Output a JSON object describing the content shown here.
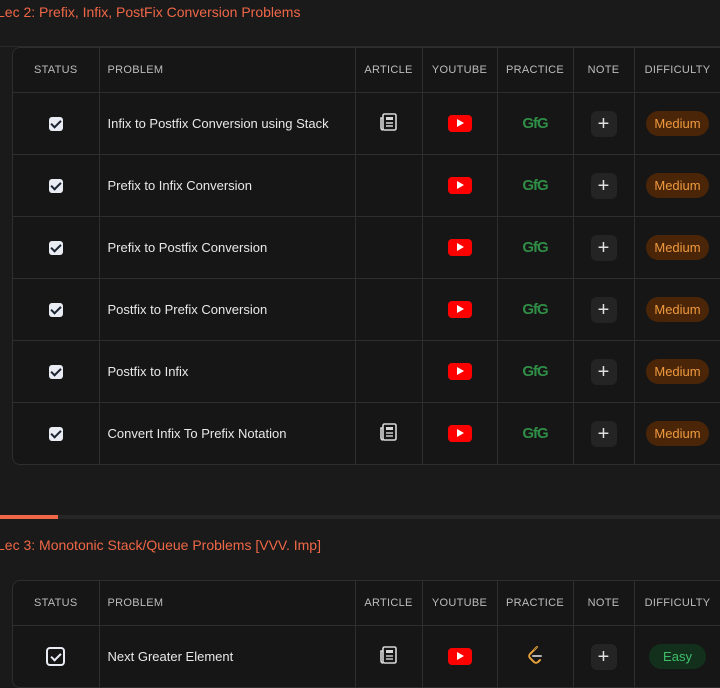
{
  "section2": {
    "title": "Lec 2: Prefix, Infix, PostFix Conversion Problems",
    "headers": {
      "status": "STATUS",
      "problem": "PROBLEM",
      "article": "ARTICLE",
      "youtube": "YOUTUBE",
      "practice": "PRACTICE",
      "note": "NOTE",
      "difficulty": "DIFFICULTY"
    },
    "rows": [
      {
        "problem": "Infix to Postfix Conversion using Stack",
        "article": true,
        "difficulty": "Medium"
      },
      {
        "problem": "Prefix to Infix Conversion",
        "article": false,
        "difficulty": "Medium"
      },
      {
        "problem": "Prefix to Postfix Conversion",
        "article": false,
        "difficulty": "Medium"
      },
      {
        "problem": "Postfix to Prefix Conversion",
        "article": false,
        "difficulty": "Medium"
      },
      {
        "problem": "Postfix to Infix",
        "article": false,
        "difficulty": "Medium"
      },
      {
        "problem": "Convert Infix To Prefix Notation",
        "article": true,
        "difficulty": "Medium"
      }
    ]
  },
  "section3": {
    "title": "Lec 3: Monotonic Stack/Queue Problems [VVV. Imp]",
    "progress": 0.08,
    "headers": {
      "status": "STATUS",
      "problem": "PROBLEM",
      "article": "ARTICLE",
      "youtube": "YOUTUBE",
      "practice": "PRACTICE",
      "note": "NOTE",
      "difficulty": "DIFFICULTY"
    },
    "rows": [
      {
        "problem": "Next Greater Element",
        "article": true,
        "difficulty": "Easy"
      }
    ]
  },
  "icons": {
    "practice_gfg": "GfG",
    "note": "+"
  },
  "colors": {
    "accent": "#ef6747",
    "youtube": "#ff0000",
    "medium": "#f09a3e",
    "easy": "#3fbf6a",
    "gfg": "#2f8d46"
  }
}
